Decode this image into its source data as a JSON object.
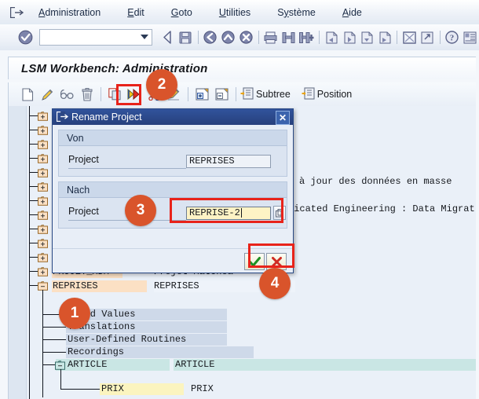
{
  "window": {
    "screen_title": "LSM Workbench: Administration"
  },
  "menubar": {
    "system_icon": "exit-arrow-icon",
    "items": [
      {
        "label": "Administration",
        "accel": "A"
      },
      {
        "label": "Edit",
        "accel": "E"
      },
      {
        "label": "Goto",
        "accel": "G"
      },
      {
        "label": "Utilities",
        "accel": "U"
      },
      {
        "label": "Système",
        "accel": "y"
      },
      {
        "label": "Aide",
        "accel": "A"
      }
    ]
  },
  "toolbar_main": {
    "ok_icon": "enter-check-icon",
    "command_field": {
      "value": "",
      "placeholder": ""
    },
    "dropdown_icon": "chevron-down-icon",
    "icons": [
      "back-arrow-icon",
      "save-icon",
      "back-green-icon",
      "exit-up-icon",
      "cancel-x-icon",
      "print-icon",
      "find-icon",
      "find-next-icon",
      "first-page-icon",
      "previous-page-icon",
      "next-page-icon",
      "last-page-icon",
      "new-session-icon",
      "create-shortcut-icon",
      "help-icon",
      "customize-layout-icon"
    ]
  },
  "toolbar_app": {
    "icons": [
      "new-document-icon",
      "edit-pencil-icon",
      "display-glasses-icon",
      "delete-trash-icon",
      "copy-icon",
      "rename-transport-icon",
      "cut-icon",
      "change-icon",
      "expand-node-icon",
      "collapse-node-icon"
    ],
    "buttons": [
      {
        "label": "Subtree",
        "icon": "subtree-icon"
      },
      {
        "label": "Position",
        "icon": "position-icon"
      }
    ],
    "highlighted_icon": "rename-transport-icon"
  },
  "dialog": {
    "title": "Rename Project",
    "system_icon": "exit-arrow-icon",
    "close_icon": "close-icon",
    "groups": [
      {
        "header": "Von",
        "field_label": "Project",
        "field_value": "REPRISES",
        "readonly": true
      },
      {
        "header": "Nach",
        "field_label": "Project",
        "field_value": "REPRISE-2",
        "readonly": false,
        "matchcode_icon": "matchcode-icon"
      }
    ],
    "confirm_icon": "green-check-icon",
    "cancel_icon": "red-x-icon"
  },
  "tree": {
    "collapsed_icon": "folder-closed-plus-icon",
    "expanded_icon": "folder-open-minus-icon",
    "hidden_rows_count": 12,
    "rows": [
      {
        "name": "PROJET_MDM",
        "description": "Projet Matchea",
        "icon": "folder-closed-plus-icon",
        "indent": 0,
        "highlight": "orange",
        "occluded": true
      },
      {
        "name": "REPRISES",
        "description": "REPRISES",
        "icon": "folder-open-minus-icon",
        "indent": 0,
        "highlight": "orange",
        "occluded": false
      },
      {
        "name": "Fixed Values",
        "description": "",
        "icon": "",
        "indent": 1,
        "highlight": "blue",
        "occluded": false
      },
      {
        "name": "Translations",
        "description": "",
        "icon": "",
        "indent": 1,
        "highlight": "blue",
        "occluded": false
      },
      {
        "name": "User-Defined Routines",
        "description": "",
        "icon": "",
        "indent": 1,
        "highlight": "blue",
        "occluded": false
      },
      {
        "name": "Recordings",
        "description": "",
        "icon": "",
        "indent": 1,
        "highlight": "blue",
        "occluded": false
      },
      {
        "name": "ARTICLE",
        "description": "ARTICLE",
        "icon": "folder-open-minus-icon",
        "indent": 1,
        "highlight": "teal",
        "occluded": false
      },
      {
        "name": "PRIX",
        "description": "PRIX",
        "icon": "",
        "indent": 2,
        "highlight": "yellow",
        "occluded": false
      }
    ],
    "background_text": [
      "à jour des données en masse",
      "ticated Engineering : Data Migrat"
    ]
  },
  "markers": [
    {
      "number": "1"
    },
    {
      "number": "2"
    },
    {
      "number": "3"
    },
    {
      "number": "4"
    }
  ],
  "colors": {
    "marker": "#d9542b",
    "highlight_box": "#e8231a",
    "dialog_titlebar": "#31539c",
    "active_field": "#fdf3c5",
    "row_orange": "#fbe0c4",
    "row_blue": "#ced9e9",
    "row_teal": "#c9e6e4",
    "row_yellow": "#fbf4bf"
  }
}
